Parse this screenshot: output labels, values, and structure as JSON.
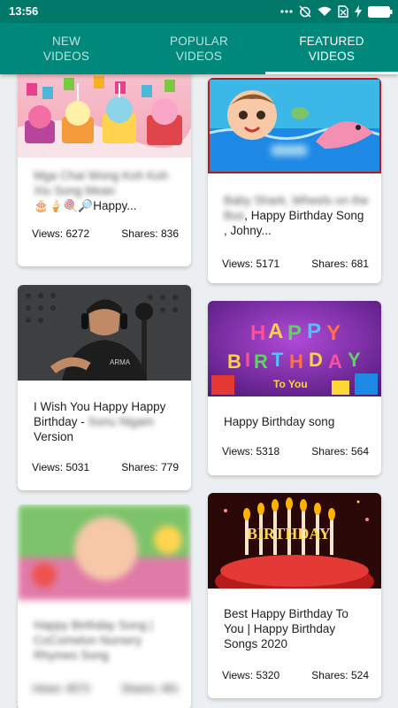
{
  "status_bar": {
    "time": "13:56"
  },
  "tabs": [
    {
      "label": "NEW\nVIDEOS",
      "active": false
    },
    {
      "label": "POPULAR\nVIDEOS",
      "active": false
    },
    {
      "label": "FEATURED\nVIDEOS",
      "active": true
    }
  ],
  "colors": {
    "status_bar": "#00796b",
    "tab_bar": "#00897b",
    "background": "#eceff1"
  },
  "videos": [
    {
      "title_visible": "🎂🍦🍭🔎Happy...",
      "title_blurred": "Mga Chai Wong Koh Koh Xiu Song Mean",
      "views": "Views: 6272",
      "shares": "Shares: 836"
    },
    {
      "title_visible": ", Happy Birthday Song , Johny...",
      "title_blurred": "Baby Shark, Wheels on the Bus",
      "views": "Views: 5171",
      "shares": "Shares: 681"
    },
    {
      "title_visible": "I Wish You Happy Happy Birthday - ",
      "title_blurred": "Sonu Nigam",
      "title_tail": " Version",
      "views": "Views: 5031",
      "shares": "Shares: 779"
    },
    {
      "title_visible": "Happy Birthday song",
      "views": "Views: 5318",
      "shares": "Shares: 564"
    },
    {
      "title_blurred": "Happy Birthday Song | CoComelon Nursery Rhymes Song",
      "views": "Views: 4573",
      "shares": "Shares: 491"
    },
    {
      "title_visible": "Best Happy Birthday To You | Happy Birthday Songs 2020",
      "views": "Views: 5320",
      "shares": "Shares: 524"
    }
  ]
}
